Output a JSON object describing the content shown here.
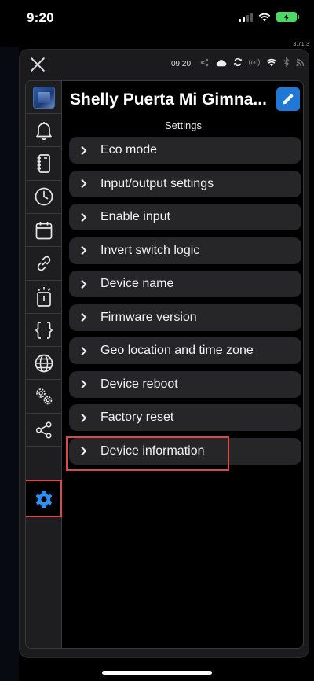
{
  "status_bar": {
    "time": "9:20",
    "icons": [
      "cellular-signal-icon",
      "wifi-icon",
      "battery-charging-icon"
    ],
    "version": "3.71.3"
  },
  "header": {
    "close_icon": "close-icon",
    "time": "09:20",
    "icons": [
      "share-icon",
      "cloud-icon",
      "sync-icon",
      "broadcast-icon",
      "wifi-icon",
      "bluetooth-icon",
      "rss-icon"
    ]
  },
  "device": {
    "title": "Shelly Puerta Mi Gimna...",
    "edit_icon": "pencil-icon",
    "thumbnail": "device-thumbnail"
  },
  "page": {
    "subtitle": "Settings"
  },
  "sidebar": {
    "items": [
      {
        "name": "device-thumbnail"
      },
      {
        "name": "bell-icon"
      },
      {
        "name": "notebook-icon"
      },
      {
        "name": "clock-icon"
      },
      {
        "name": "calendar-icon"
      },
      {
        "name": "link-icon"
      },
      {
        "name": "light-icon"
      },
      {
        "name": "code-braces-icon"
      },
      {
        "name": "globe-icon"
      },
      {
        "name": "gears-icon"
      },
      {
        "name": "share-icon"
      },
      {
        "name": "settings-gear-icon",
        "active": true
      }
    ]
  },
  "menu": {
    "items": [
      {
        "label": "Eco mode"
      },
      {
        "label": "Input/output settings"
      },
      {
        "label": "Enable input"
      },
      {
        "label": "Invert switch logic"
      },
      {
        "label": "Device name"
      },
      {
        "label": "Firmware version"
      },
      {
        "label": "Geo location and time zone"
      },
      {
        "label": "Device reboot"
      },
      {
        "label": "Factory reset"
      },
      {
        "label": "Device information",
        "highlighted": true
      }
    ]
  },
  "colors": {
    "accent": "#1f78d6",
    "highlight": "#e04848",
    "panel": "#1b1b1d",
    "menu_item": "#262628"
  }
}
